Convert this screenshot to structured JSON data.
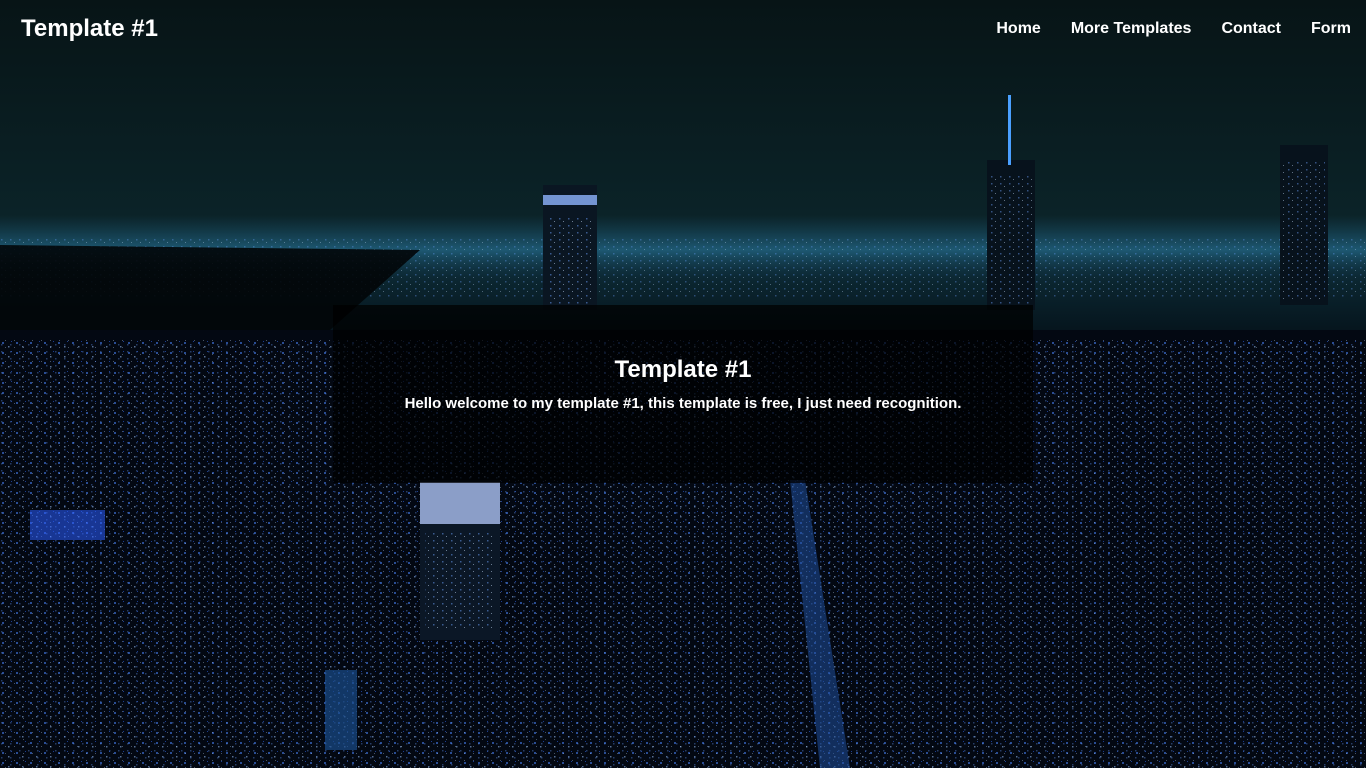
{
  "navbar": {
    "brand": "Template #1",
    "links": [
      {
        "label": "Home"
      },
      {
        "label": "More Templates"
      },
      {
        "label": "Contact"
      },
      {
        "label": "Form"
      }
    ]
  },
  "hero": {
    "title": "Template #1",
    "text": "Hello welcome to my template #1, this template is free, I just need recognition."
  },
  "colors": {
    "text": "#ffffff",
    "sky": "#071a1c",
    "city_lights": "#3a7cff",
    "overlay": "#000000"
  }
}
